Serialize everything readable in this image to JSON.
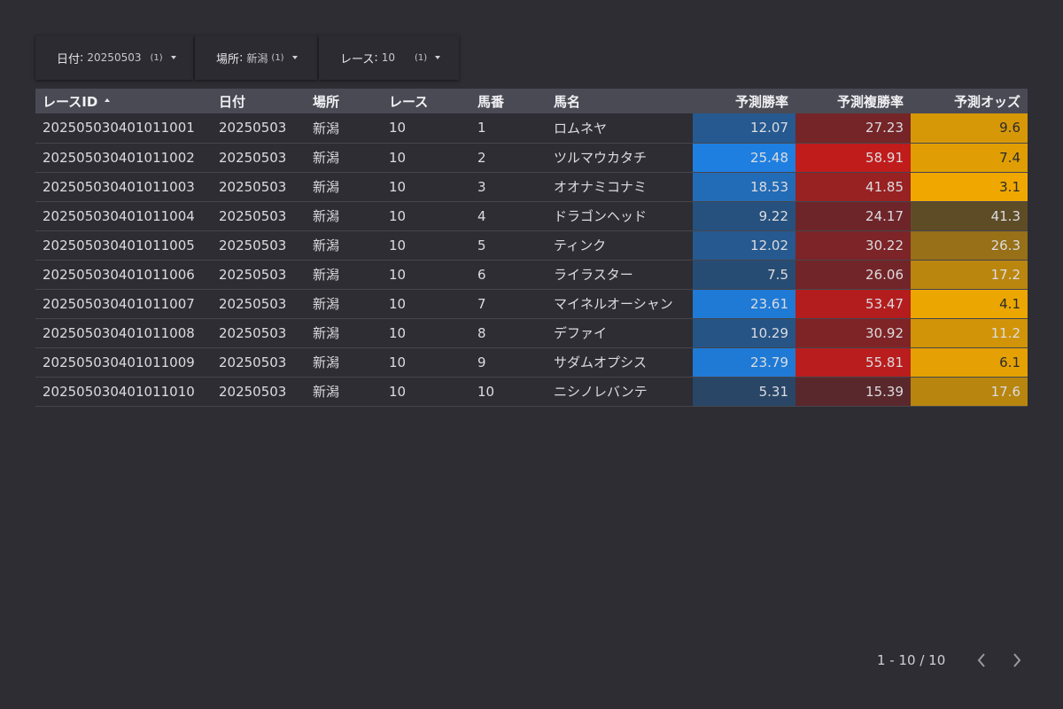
{
  "filters": [
    {
      "label": "日付",
      "value": "20250503",
      "count": "(1)",
      "icon": "caret-down-icon"
    },
    {
      "label": "場所",
      "value": "新潟",
      "count": "(1)",
      "icon": "caret-down-icon"
    },
    {
      "label": "レース",
      "value": "10",
      "count": "(1)",
      "icon": "caret-down-icon"
    }
  ],
  "table": {
    "headers": [
      "レースID",
      "日付",
      "場所",
      "レース",
      "馬番",
      "馬名",
      "予測勝率",
      "予測複勝率",
      "予測オッズ"
    ],
    "sort": {
      "column": "レースID",
      "direction": "ascending",
      "icon": "sort-ascending-icon"
    },
    "rows": [
      [
        "202505030401011001",
        "20250503",
        "新潟",
        "10",
        "1",
        "ロムネヤ",
        "12.07",
        "27.23",
        "9.6"
      ],
      [
        "202505030401011002",
        "20250503",
        "新潟",
        "10",
        "2",
        "ツルマウカタチ",
        "25.48",
        "58.91",
        "7.4"
      ],
      [
        "202505030401011003",
        "20250503",
        "新潟",
        "10",
        "3",
        "オオナミコナミ",
        "18.53",
        "41.85",
        "3.1"
      ],
      [
        "202505030401011004",
        "20250503",
        "新潟",
        "10",
        "4",
        "ドラゴンヘッド",
        "9.22",
        "24.17",
        "41.3"
      ],
      [
        "202505030401011005",
        "20250503",
        "新潟",
        "10",
        "5",
        "ティンク",
        "12.02",
        "30.22",
        "26.3"
      ],
      [
        "202505030401011006",
        "20250503",
        "新潟",
        "10",
        "6",
        "ライラスター",
        "7.5",
        "26.06",
        "17.2"
      ],
      [
        "202505030401011007",
        "20250503",
        "新潟",
        "10",
        "7",
        "マイネルオーシャン",
        "23.61",
        "53.47",
        "4.1"
      ],
      [
        "202505030401011008",
        "20250503",
        "新潟",
        "10",
        "8",
        "デファイ",
        "10.29",
        "30.92",
        "11.2"
      ],
      [
        "202505030401011009",
        "20250503",
        "新潟",
        "10",
        "9",
        "サダムオプシス",
        "23.79",
        "55.81",
        "6.1"
      ],
      [
        "202505030401011010",
        "20250503",
        "新潟",
        "10",
        "10",
        "ニシノレバンテ",
        "5.31",
        "15.39",
        "17.6"
      ]
    ],
    "heatmap_colors": {
      "win_rate": "#1e7fe0",
      "place_rate": "#c01c1c",
      "odds": "#f0a800",
      "base": "#2d2d33"
    }
  },
  "pagination": {
    "text": "1 - 10 / 10",
    "prev_icon": "chevron-left-icon",
    "next_icon": "chevron-right-icon"
  }
}
